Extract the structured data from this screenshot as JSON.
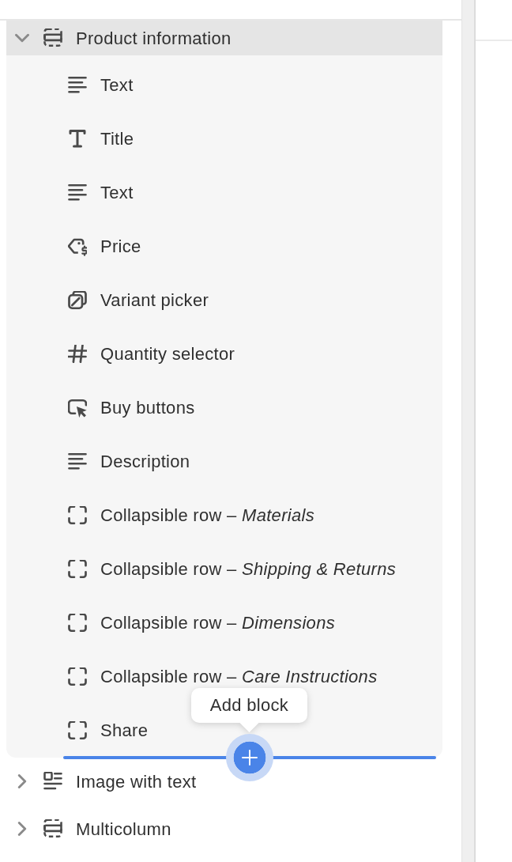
{
  "sections": [
    {
      "kind": "section",
      "title": "Product information",
      "expanded": true,
      "selected": true,
      "blocks": [
        {
          "kind": "text",
          "label": "Text"
        },
        {
          "kind": "title",
          "label": "Title"
        },
        {
          "kind": "text",
          "label": "Text"
        },
        {
          "kind": "price",
          "label": "Price"
        },
        {
          "kind": "variant",
          "label": "Variant picker"
        },
        {
          "kind": "quantity",
          "label": "Quantity selector"
        },
        {
          "kind": "buy",
          "label": "Buy buttons"
        },
        {
          "kind": "text",
          "label": "Description"
        },
        {
          "kind": "block",
          "label": "Collapsible row – *Materials*"
        },
        {
          "kind": "block",
          "label": "Collapsible row – *Shipping & Returns*"
        },
        {
          "kind": "block",
          "label": "Collapsible row – *Dimensions*"
        },
        {
          "kind": "block",
          "label": "Collapsible row – *Care Instructions*"
        },
        {
          "kind": "block",
          "label": "Share"
        }
      ]
    },
    {
      "kind": "image",
      "title": "Image with text",
      "expanded": false,
      "selected": false
    },
    {
      "kind": "section",
      "title": "Multicolumn",
      "expanded": false,
      "selected": false
    }
  ],
  "insert_indicator": {
    "tooltip": "Add block"
  }
}
